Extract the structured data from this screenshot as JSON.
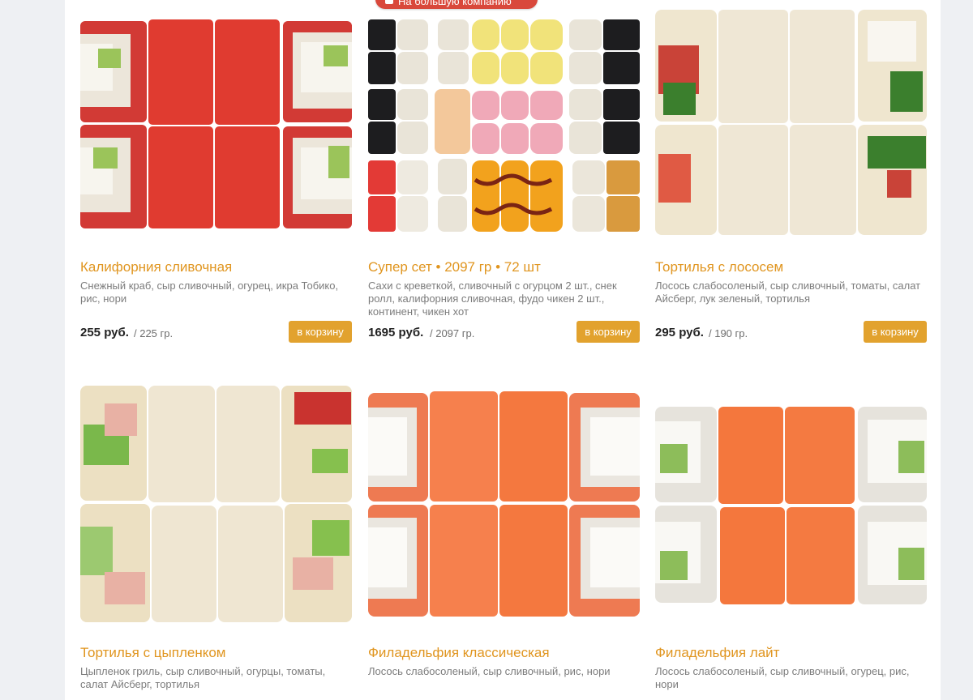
{
  "badge": {
    "label": "На большую компанию",
    "icon": "group-icon"
  },
  "cart_label": "в корзину",
  "products": [
    {
      "title": "Калифорния сливочная",
      "description": "Снежный краб, сыр сливочный, огурец, икра Тобико, рис, нори",
      "price": "255 руб.",
      "weight": "/ 225 гр."
    },
    {
      "title": "Супер сет • 2097 гр • 72 шт",
      "description": "Сахи с креветкой, сливочный с огурцом 2 шт., снек ролл, калифорния сливочная, фудо чикен 2 шт., континент, чикен хот",
      "price": "1695 руб.",
      "weight": "/ 2097 гр."
    },
    {
      "title": "Тортилья с лососем",
      "description": "Лосось слабосоленый, сыр сливочный, томаты, салат Айсберг, лук зеленый, тортилья",
      "price": "295 руб.",
      "weight": "/ 190 гр."
    },
    {
      "title": "Тортилья с цыпленком",
      "description": "Цыпленок гриль, сыр сливочный, огурцы, томаты, салат Айсберг, тортилья"
    },
    {
      "title": "Филадельфия классическая",
      "description": "Лосось слабосоленый, сыр сливочный, рис, нори"
    },
    {
      "title": "Филадельфия лайт",
      "description": "Лосось слабосоленый, сыр сливочный, огурец, рис, нори"
    }
  ]
}
